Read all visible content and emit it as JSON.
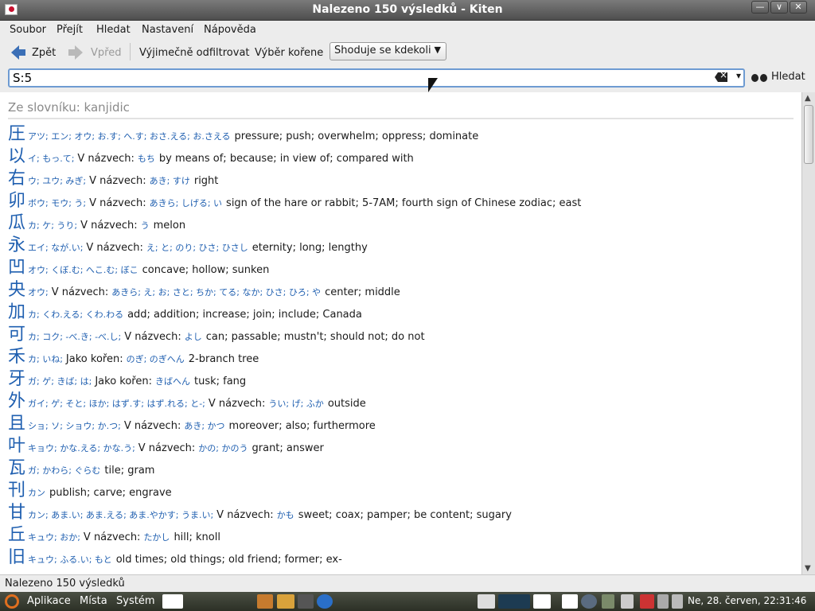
{
  "window": {
    "title": "Nalezeno 150 výsledků - Kiten",
    "buttons": [
      "—",
      "∨",
      "✕"
    ]
  },
  "menu": [
    "Soubor",
    "Přejít",
    "Hledat",
    "Nastavení",
    "Nápověda"
  ],
  "toolbar": {
    "back_label": "Zpět",
    "forward_label": "Vpřed",
    "filter_label": "Výjimečně odfiltrovat",
    "radical_label": "Výběr kořene",
    "match_mode": "Shoduje se kdekoli"
  },
  "search": {
    "value": "S:5",
    "button_label": "Hledat"
  },
  "results": {
    "header": "Ze slovníku: kanjidic",
    "rows": [
      {
        "kanji": "圧",
        "readings": "アツ; エン; オウ; お.す; へ.す; おさ.える; お.さえる",
        "label": "",
        "names": "",
        "meaning": "pressure; push; overwhelm; oppress; dominate"
      },
      {
        "kanji": "以",
        "readings": "イ; もっ.て;",
        "label": "V názvech:",
        "names": "もち",
        "meaning": "by means of; because; in view of; compared with"
      },
      {
        "kanji": "右",
        "readings": "ウ; ユウ; みぎ;",
        "label": "V názvech:",
        "names": "あき; すけ",
        "meaning": "right"
      },
      {
        "kanji": "卯",
        "readings": "ボウ; モウ; う;",
        "label": "V názvech:",
        "names": "あきら; しげる; い",
        "meaning": "sign of the hare or rabbit; 5-7AM; fourth sign of Chinese zodiac; east"
      },
      {
        "kanji": "瓜",
        "readings": "カ; ケ; うり;",
        "label": "V názvech:",
        "names": "う",
        "meaning": "melon"
      },
      {
        "kanji": "永",
        "readings": "エイ; なが.い;",
        "label": "V názvech:",
        "names": "え; と; のり; ひさ; ひさし",
        "meaning": "eternity; long; lengthy"
      },
      {
        "kanji": "凹",
        "readings": "オウ; くぼ.む; へこ.む; ぼこ",
        "label": "",
        "names": "",
        "meaning": "concave; hollow; sunken"
      },
      {
        "kanji": "央",
        "readings": "オウ;",
        "label": "V názvech:",
        "names": "あきら; え; お; さと; ちか; てる; なか; ひさ; ひろ; や",
        "meaning": "center; middle"
      },
      {
        "kanji": "加",
        "readings": "カ; くわ.える; くわ.わる",
        "label": "",
        "names": "",
        "meaning": "add; addition; increase; join; include; Canada"
      },
      {
        "kanji": "可",
        "readings": "カ; コク; -べ.き; -べ.し;",
        "label": "V názvech:",
        "names": "よし",
        "meaning": "can; passable; mustn't; should not; do not"
      },
      {
        "kanji": "禾",
        "readings": "カ; いね;",
        "label": "Jako kořen:",
        "names": "のぎ; のぎへん",
        "meaning": "2-branch tree"
      },
      {
        "kanji": "牙",
        "readings": "ガ; ゲ; きば; は;",
        "label": "Jako kořen:",
        "names": "きばへん",
        "meaning": "tusk; fang"
      },
      {
        "kanji": "外",
        "readings": "ガイ; ゲ; そと; ほか; はず.す; はず.れる; と-;",
        "label": "V názvech:",
        "names": "うい; げ; ふか",
        "meaning": "outside"
      },
      {
        "kanji": "且",
        "readings": "ショ; ソ; ショウ; か.つ;",
        "label": "V názvech:",
        "names": "あき; かつ",
        "meaning": "moreover; also; furthermore"
      },
      {
        "kanji": "叶",
        "readings": "キョウ; かな.える; かな.う;",
        "label": "V názvech:",
        "names": "かの; かのう",
        "meaning": "grant; answer"
      },
      {
        "kanji": "瓦",
        "readings": "ガ; かわら; ぐらむ",
        "label": "",
        "names": "",
        "meaning": "tile; gram"
      },
      {
        "kanji": "刊",
        "readings": "カン",
        "label": "",
        "names": "",
        "meaning": "publish; carve; engrave"
      },
      {
        "kanji": "甘",
        "readings": "カン; あま.い; あま.える; あま.やかす; うま.い;",
        "label": "V názvech:",
        "names": "かも",
        "meaning": "sweet; coax; pamper; be content; sugary"
      },
      {
        "kanji": "丘",
        "readings": "キュウ; おか;",
        "label": "V názvech:",
        "names": "たかし",
        "meaning": "hill; knoll"
      },
      {
        "kanji": "旧",
        "readings": "キュウ; ふる.い; もと",
        "label": "",
        "names": "",
        "meaning": "old times; old things; old friend; former; ex-"
      }
    ]
  },
  "status": "Nalezeno 150 výsledků",
  "taskbar": {
    "menus": [
      "Aplikace",
      "Místa",
      "Systém"
    ],
    "clock": "Ne, 28. červen, 22:31:46"
  },
  "colors": {
    "kanji": "#1f5fb0",
    "accent": "#6e9bd2",
    "taskbar": "#3a3f33"
  }
}
